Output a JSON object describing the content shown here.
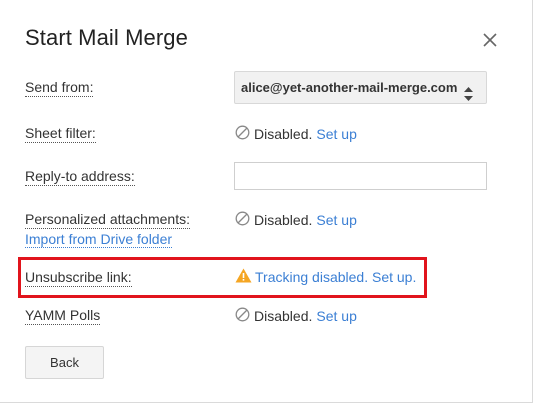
{
  "dialog": {
    "title": "Start Mail Merge",
    "close_icon": "close-icon"
  },
  "fields": {
    "send_from": {
      "label": "Send from:",
      "value": "alice@yet-another-mail-merge.com"
    },
    "sheet_filter": {
      "label": "Sheet filter:",
      "status": "Disabled.",
      "action": "Set up"
    },
    "reply_to": {
      "label": "Reply-to address:",
      "value": ""
    },
    "personalized_attachments": {
      "label": "Personalized attachments:",
      "link": "Import from Drive folder",
      "status": "Disabled.",
      "action": "Set up"
    },
    "unsubscribe": {
      "label": "Unsubscribe link:",
      "status": "Tracking disabled. Set up.",
      "icon": "warning-icon"
    },
    "yamm_polls": {
      "label": "YAMM Polls",
      "status": "Disabled.",
      "action": "Set up"
    }
  },
  "buttons": {
    "back": "Back"
  },
  "colors": {
    "link": "#3b7fd4",
    "highlight": "#e1141c",
    "warning": "#f5a623"
  }
}
